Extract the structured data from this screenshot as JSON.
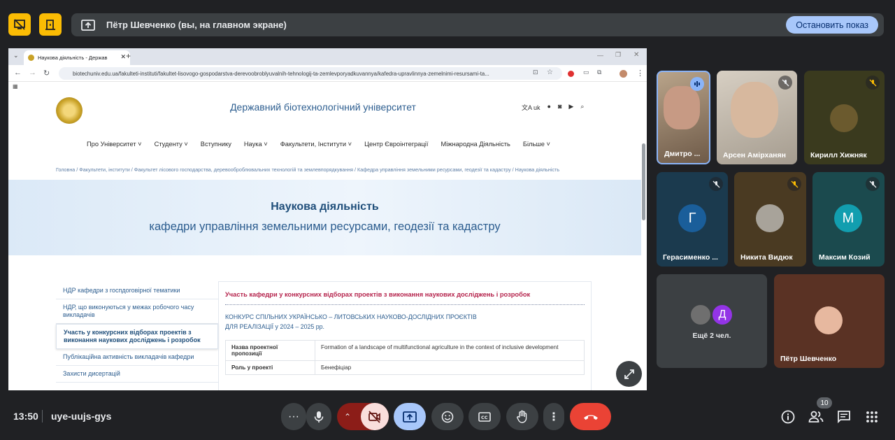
{
  "presentation": {
    "banner_text": "Пётр Шевченко (вы, на главном экране)",
    "stop_label": "Остановить показ"
  },
  "browser": {
    "tab_title": "Наукова діяльність - Держав",
    "url": "biotechuniv.edu.ua/fakulteti-instituti/fakultet-lisovogo-gospodarstva-derevoobroblyuvalnih-tehnologij-ta-zemlevporyadkuvannya/kafedra-upravlinnya-zemelnimi-resursami-ta..."
  },
  "site": {
    "title": "Державний біотехнологічний університет",
    "lang": "uk",
    "menu": [
      "Про Університет",
      "Студенту",
      "Вступнику",
      "Наука",
      "Факультети, Інститути",
      "Центр Євроінтеграції",
      "Міжнародна Діяльність",
      "Більше"
    ],
    "breadcrumb": "Головна / Факультети, інститути / Факультет лісового господарства, деревооброблювальних технологій та землевпорядкування / Кафедра управління земельними ресурсами, геодезії та кадастру / Наукова діяльність",
    "hero_title": "Наукова діяльність",
    "hero_subtitle": "кафедри управління земельними ресурсами, геодезії та кадастру",
    "sidebar": [
      "НДР кафедри з госпдоговірної тематики",
      "НДР, що виконуються у межах робочого часу викладачів",
      "Участь у конкурсних відборах проектів з виконання наукових досліджень і розробок",
      "Публікаційна активність викладачів кафедри",
      "Захисти дисертацій"
    ],
    "content_heading": "Участь кафедри у конкурсних відборах проектів з виконання наукових досліджень і розробок",
    "content_sub1": "КОНКУРС СПІЛЬНИХ УКРАЇНСЬКО – ЛИТОВСЬКИХ НАУКОВО-ДОСЛІДНИХ ПРОЄКТІВ",
    "content_sub2": "ДЛЯ РЕАЛІЗАЦІЇ у 2024 – 2025 рр.",
    "table": [
      {
        "k": "Назва проектної пропозиції",
        "v": "Formation of a landscape of multifunctional agriculture in the context of inclusive development"
      },
      {
        "k": "Роль у проекті",
        "v": "Бенефіціар"
      }
    ]
  },
  "participants": [
    {
      "name": "Дмитро ...",
      "type": "video",
      "speaking": true
    },
    {
      "name": "Арсен Амірханян",
      "type": "video",
      "muted": true
    },
    {
      "name": "Кирилл Хижняк",
      "type": "photo",
      "muted": true
    },
    {
      "name": "Герасименко ...",
      "type": "letter",
      "letter": "Г",
      "muted": true
    },
    {
      "name": "Никита Видюк",
      "type": "photo",
      "muted": true
    },
    {
      "name": "Максим Козий",
      "type": "letter",
      "letter": "М",
      "muted": true
    }
  ],
  "others": {
    "label": "Ещё 2 чел.",
    "letter": "Д"
  },
  "self_tile": {
    "name": "Пётр Шевченко"
  },
  "meeting": {
    "time": "13:50",
    "code": "uye-uujs-gys",
    "people_count": "10"
  },
  "colors": {
    "accent_yellow": "#fbbc04",
    "end_call": "#ea4335",
    "present_blue": "#a8c7fa",
    "cam_off": "#f9dedc"
  }
}
